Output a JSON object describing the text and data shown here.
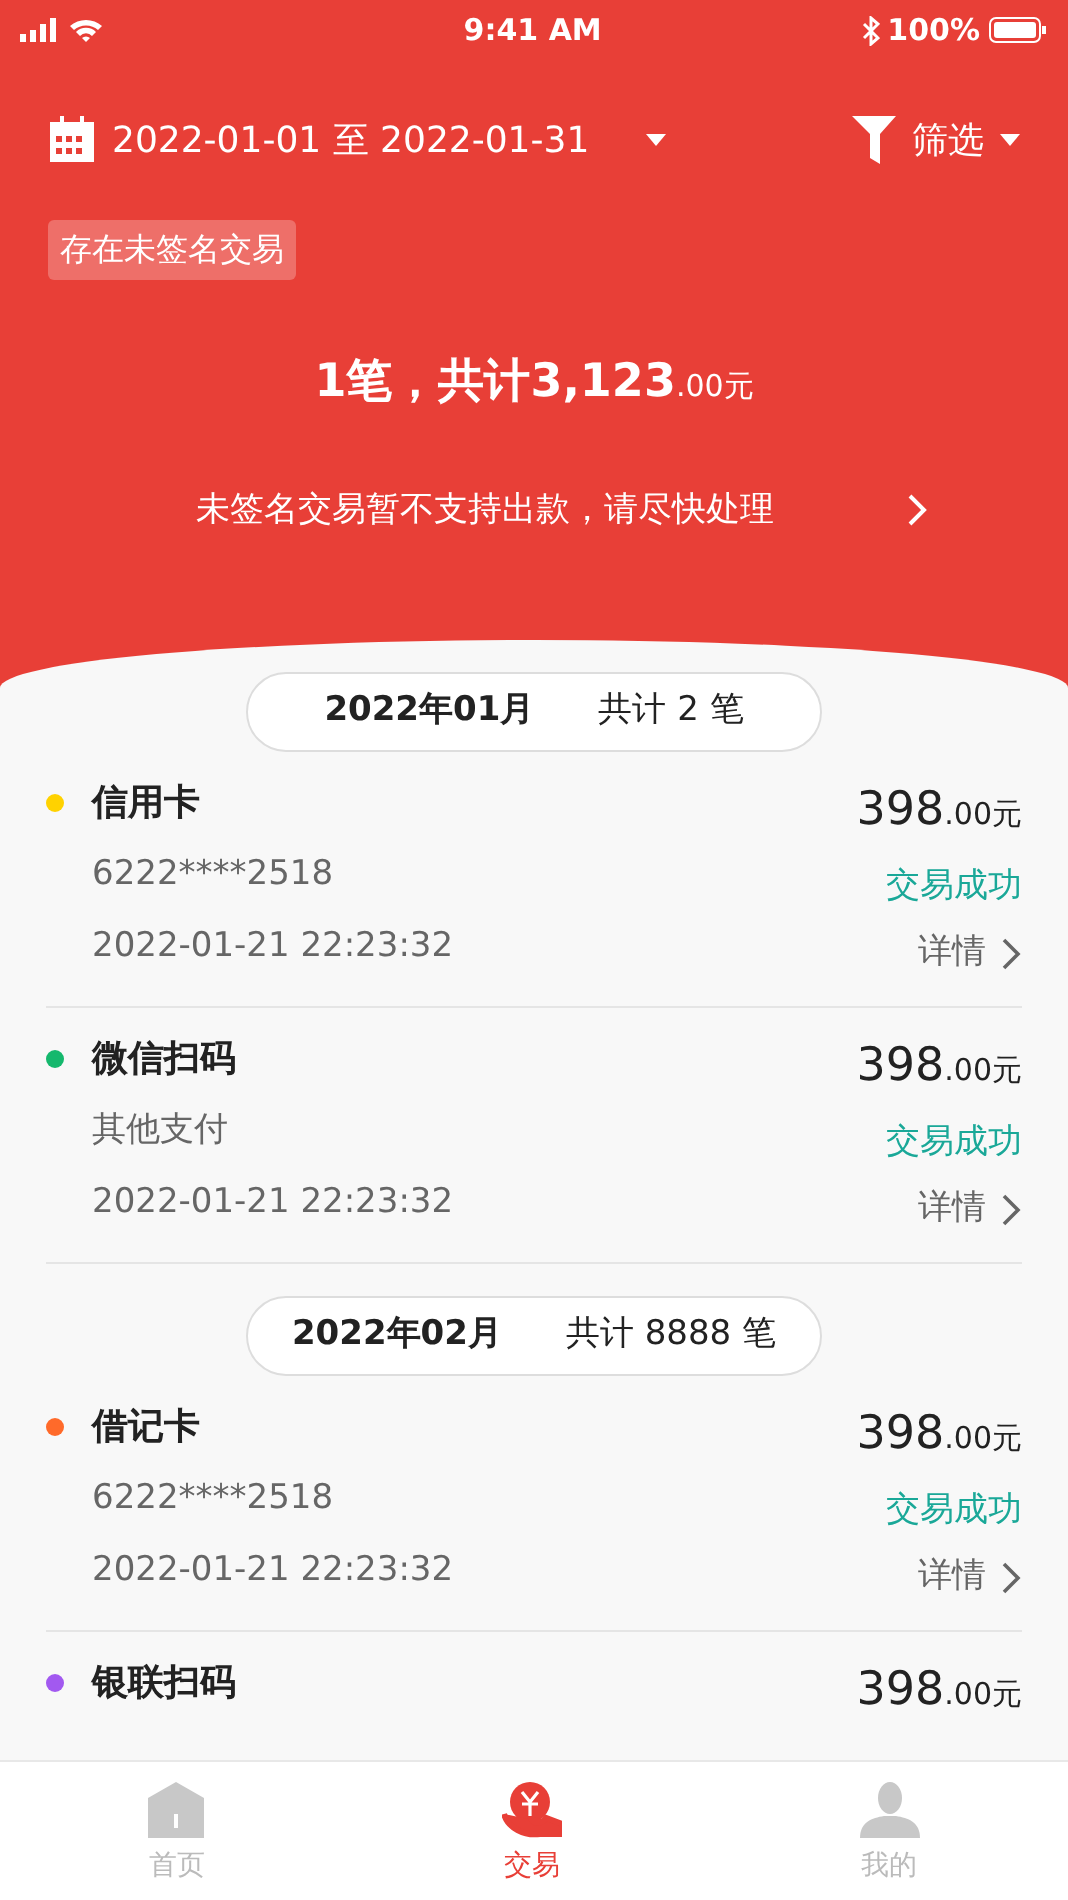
{
  "status_bar": {
    "time": "9:41 AM",
    "battery": "100%"
  },
  "filter": {
    "date_range": "2022-01-01 至 2022-01-31",
    "filter_label": "筛选"
  },
  "badge": "存在未签名交易",
  "summary": {
    "main": "1笔，共计3,123",
    "small": ".00元"
  },
  "notice": "未签名交易暂不支持出款，请尽快处理",
  "groups": [
    {
      "month": "2022年01月",
      "count": "共计 2 笔",
      "transactions": [
        {
          "name": "信用卡",
          "color": "#ffd200",
          "detail": "6222****2518",
          "time": "2022-01-21 22:23:32",
          "amount": "398",
          "amount_small": ".00元",
          "status": "交易成功",
          "link": "详情"
        },
        {
          "name": "微信扫码",
          "color": "#15b86d",
          "detail": "其他支付",
          "time": "2022-01-21 22:23:32",
          "amount": "398",
          "amount_small": ".00元",
          "status": "交易成功",
          "link": "详情"
        }
      ]
    },
    {
      "month": "2022年02月",
      "count": "共计 8888 笔",
      "transactions": [
        {
          "name": "借记卡",
          "color": "#ff6a2a",
          "detail": "6222****2518",
          "time": "2022-01-21 22:23:32",
          "amount": "398",
          "amount_small": ".00元",
          "status": "交易成功",
          "link": "详情"
        },
        {
          "name": "银联扫码",
          "color": "#a259f0",
          "amount": "398",
          "amount_small": ".00元"
        }
      ]
    }
  ],
  "tabs": [
    {
      "label": "首页",
      "kind": "home",
      "selected": false
    },
    {
      "label": "交易",
      "kind": "trade",
      "selected": true
    },
    {
      "label": "我的",
      "kind": "me",
      "selected": false
    }
  ]
}
